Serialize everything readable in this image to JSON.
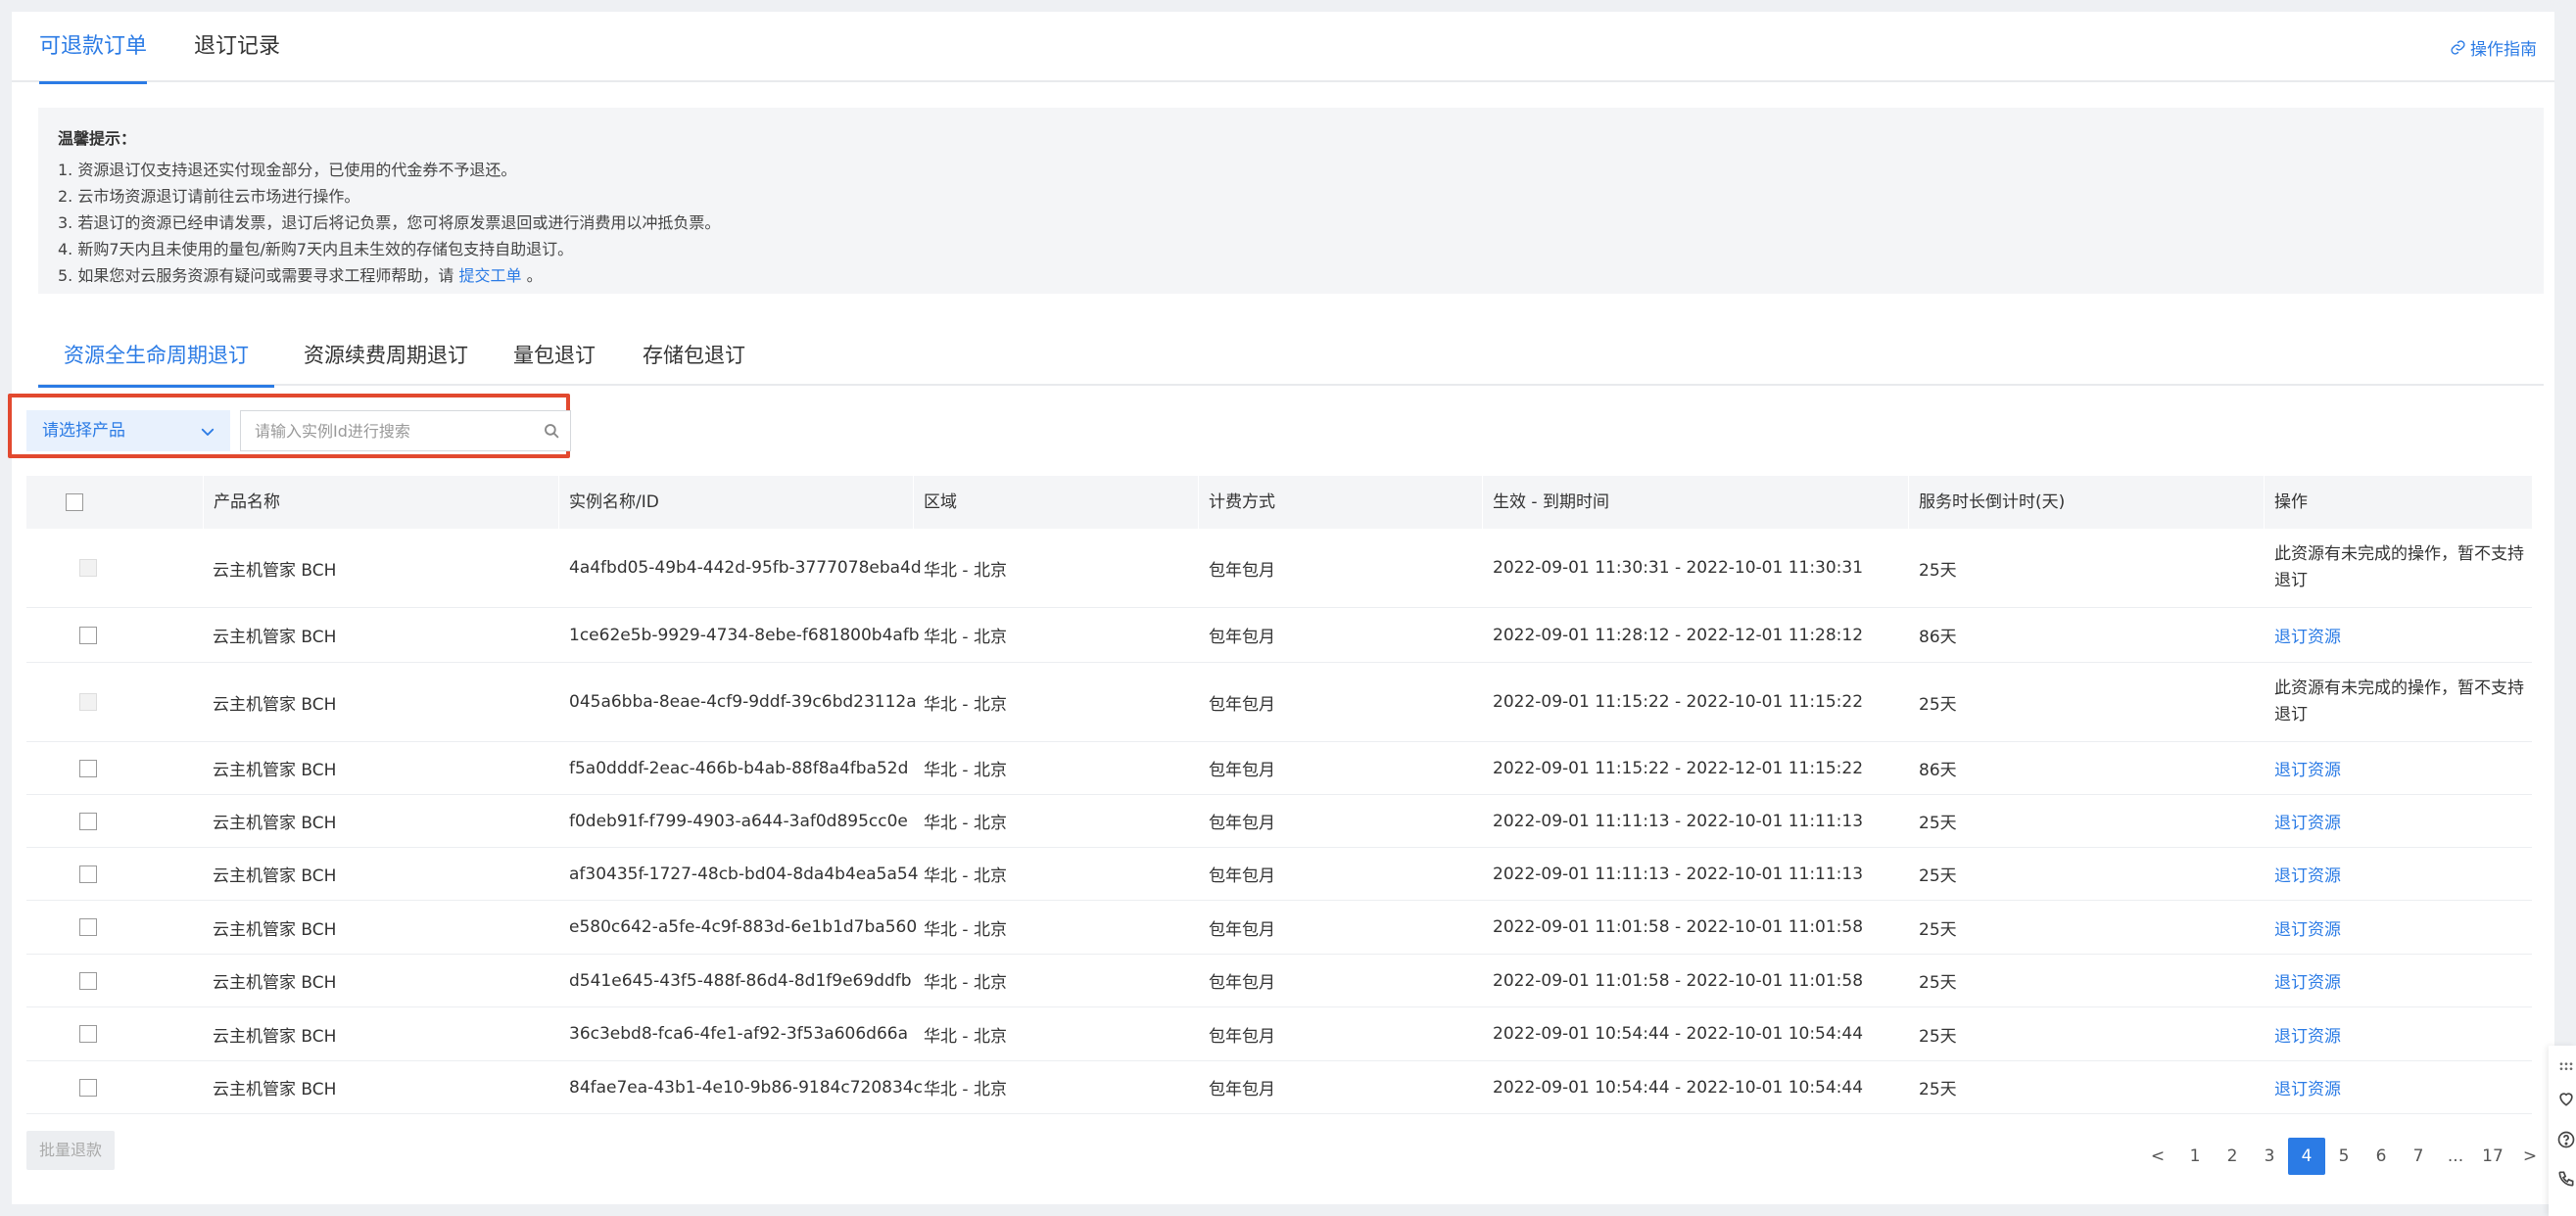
{
  "top_tabs": [
    {
      "label": "可退款订单"
    },
    {
      "label": "退订记录"
    }
  ],
  "guide_label": "操作指南",
  "notice": {
    "title": "温馨提示：",
    "lines": [
      "1. 资源退订仅支持退还实付现金部分，已使用的代金券不予退还。",
      "2. 云市场资源退订请前往云市场进行操作。",
      "3. 若退订的资源已经申请发票，退订后将记负票，您可将原发票退回或进行消费用以冲抵负票。",
      "4. 新购7天内且未使用的量包/新购7天内且未生效的存储包支持自助退订。"
    ],
    "line5_prefix": "5. 如果您对云服务资源有疑问或需要寻求工程师帮助，请",
    "line5_link": "提交工单",
    "line5_suffix": "。"
  },
  "sub_tabs": [
    {
      "label": "资源全生命周期退订"
    },
    {
      "label": "资源续费周期退订"
    },
    {
      "label": "量包退订"
    },
    {
      "label": "存储包退订"
    }
  ],
  "filter": {
    "product_select": "请选择产品",
    "search_placeholder": "请输入实例Id进行搜索"
  },
  "table": {
    "columns": [
      "产品名称",
      "实例名称/ID",
      "区域",
      "计费方式",
      "生效 - 到期时间",
      "服务时长倒计时(天)",
      "操作"
    ],
    "rows": [
      {
        "product": "云主机管家 BCH",
        "id": "4a4fbd05-49b4-442d-95fb-3777078eba4d",
        "region": "华北 - 北京",
        "billing": "包年包月",
        "period": "2022-09-01 11:30:31 - 2022-10-01 11:30:31",
        "days": "25天",
        "op": "此资源有未完成的操作，暂不支持退订",
        "disabled": true
      },
      {
        "product": "云主机管家 BCH",
        "id": "1ce62e5b-9929-4734-8ebe-f681800b4afb",
        "region": "华北 - 北京",
        "billing": "包年包月",
        "period": "2022-09-01 11:28:12 - 2022-12-01 11:28:12",
        "days": "86天",
        "op": "退订资源",
        "disabled": false
      },
      {
        "product": "云主机管家 BCH",
        "id": "045a6bba-8eae-4cf9-9ddf-39c6bd23112a",
        "region": "华北 - 北京",
        "billing": "包年包月",
        "period": "2022-09-01 11:15:22 - 2022-10-01 11:15:22",
        "days": "25天",
        "op": "此资源有未完成的操作，暂不支持退订",
        "disabled": true
      },
      {
        "product": "云主机管家 BCH",
        "id": "f5a0dddf-2eac-466b-b4ab-88f8a4fba52d",
        "region": "华北 - 北京",
        "billing": "包年包月",
        "period": "2022-09-01 11:15:22 - 2022-12-01 11:15:22",
        "days": "86天",
        "op": "退订资源",
        "disabled": false
      },
      {
        "product": "云主机管家 BCH",
        "id": "f0deb91f-f799-4903-a644-3af0d895cc0e",
        "region": "华北 - 北京",
        "billing": "包年包月",
        "period": "2022-09-01 11:11:13 - 2022-10-01 11:11:13",
        "days": "25天",
        "op": "退订资源",
        "disabled": false
      },
      {
        "product": "云主机管家 BCH",
        "id": "af30435f-1727-48cb-bd04-8da4b4ea5a54",
        "region": "华北 - 北京",
        "billing": "包年包月",
        "period": "2022-09-01 11:11:13 - 2022-10-01 11:11:13",
        "days": "25天",
        "op": "退订资源",
        "disabled": false
      },
      {
        "product": "云主机管家 BCH",
        "id": "e580c642-a5fe-4c9f-883d-6e1b1d7ba560",
        "region": "华北 - 北京",
        "billing": "包年包月",
        "period": "2022-09-01 11:01:58 - 2022-10-01 11:01:58",
        "days": "25天",
        "op": "退订资源",
        "disabled": false
      },
      {
        "product": "云主机管家 BCH",
        "id": "d541e645-43f5-488f-86d4-8d1f9e69ddfb",
        "region": "华北 - 北京",
        "billing": "包年包月",
        "period": "2022-09-01 11:01:58 - 2022-10-01 11:01:58",
        "days": "25天",
        "op": "退订资源",
        "disabled": false
      },
      {
        "product": "云主机管家 BCH",
        "id": "36c3ebd8-fca6-4fe1-af92-3f53a606d66a",
        "region": "华北 - 北京",
        "billing": "包年包月",
        "period": "2022-09-01 10:54:44 - 2022-10-01 10:54:44",
        "days": "25天",
        "op": "退订资源",
        "disabled": false
      },
      {
        "product": "云主机管家 BCH",
        "id": "84fae7ea-43b1-4e10-9b86-9184c720834c",
        "region": "华北 - 北京",
        "billing": "包年包月",
        "period": "2022-09-01 10:54:44 - 2022-10-01 10:54:44",
        "days": "25天",
        "op": "退订资源",
        "disabled": false
      }
    ]
  },
  "batch_button": "批量退款",
  "pagination": {
    "prev": "<",
    "pages": [
      "1",
      "2",
      "3",
      "4",
      "5",
      "6",
      "7",
      "...",
      "17"
    ],
    "current": "4",
    "next": ">"
  },
  "colors": {
    "accent": "#2b7be5",
    "highlight_border": "#e2492f"
  }
}
